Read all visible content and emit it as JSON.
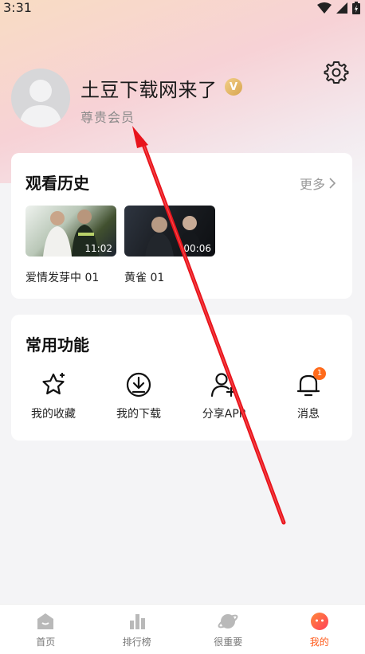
{
  "status_bar": {
    "time": "3:31"
  },
  "profile": {
    "username": "土豆下载网来了",
    "vip_badge": "V",
    "member_level": "尊贵会员"
  },
  "history": {
    "title": "观看历史",
    "more_label": "更多",
    "items": [
      {
        "title": "爱情发芽中 01",
        "duration": "11:02"
      },
      {
        "title": "黄雀 01",
        "duration": "00:06"
      }
    ]
  },
  "functions": {
    "title": "常用功能",
    "items": [
      {
        "label": "我的收藏",
        "icon": "star-icon"
      },
      {
        "label": "我的下载",
        "icon": "download-icon"
      },
      {
        "label": "分享APP",
        "icon": "share-user-icon"
      },
      {
        "label": "消息",
        "icon": "bell-icon",
        "badge": "1"
      }
    ]
  },
  "bottom_nav": {
    "items": [
      {
        "label": "首页",
        "icon": "home-icon"
      },
      {
        "label": "排行榜",
        "icon": "ranking-icon"
      },
      {
        "label": "很重要",
        "icon": "planet-icon"
      },
      {
        "label": "我的",
        "icon": "profile-face-icon",
        "active": true
      }
    ]
  },
  "colors": {
    "accent": "#ff5a1a",
    "annotation_arrow": "#e8141c"
  }
}
